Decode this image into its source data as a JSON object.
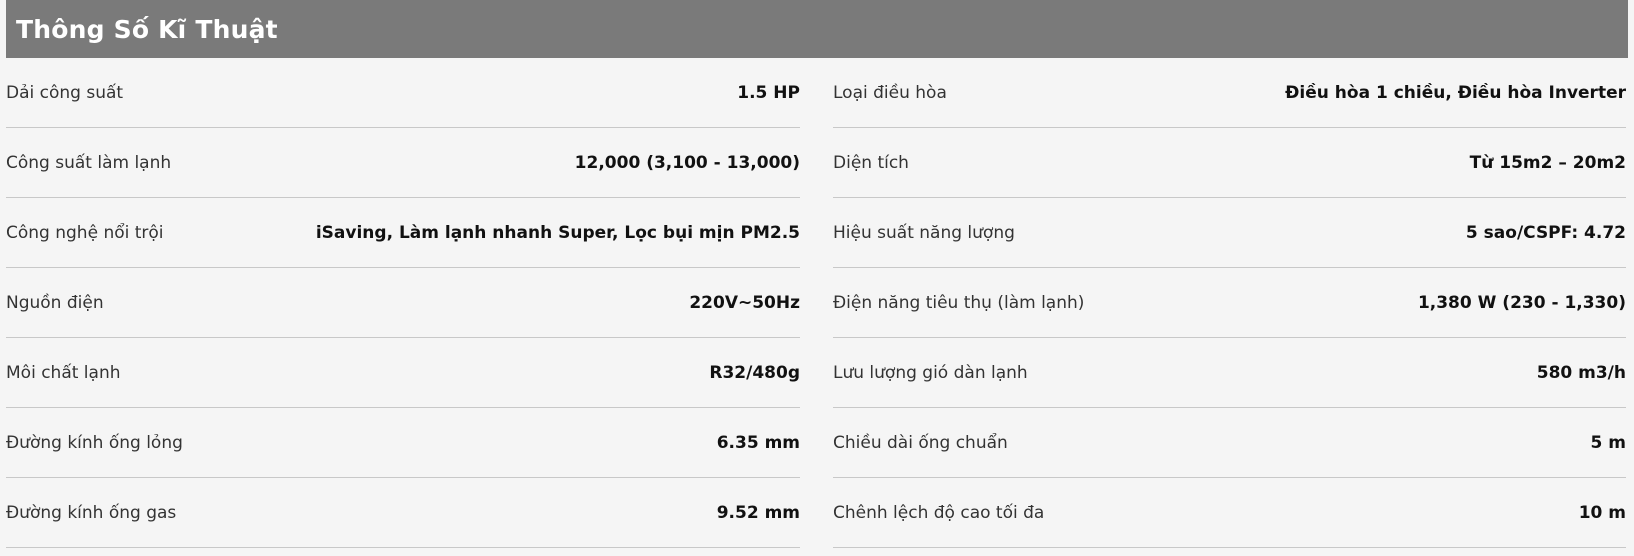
{
  "header": {
    "title": "Thông Số Kĩ Thuật"
  },
  "left": [
    {
      "label": "Dải công suất",
      "value": "1.5 HP"
    },
    {
      "label": "Công suất làm lạnh",
      "value": "12,000 (3,100 - 13,000)"
    },
    {
      "label": "Công nghệ nổi trội",
      "value": "iSaving, Làm lạnh nhanh Super, Lọc bụi mịn PM2.5"
    },
    {
      "label": "Nguồn điện",
      "value": "220V~50Hz"
    },
    {
      "label": "Môi chất lạnh",
      "value": "R32/480g"
    },
    {
      "label": "Đường kính ống lỏng",
      "value": "6.35 mm"
    },
    {
      "label": "Đường kính ống gas",
      "value": "9.52 mm"
    }
  ],
  "right": [
    {
      "label": "Loại điều hòa",
      "value": "Điều hòa 1 chiều, Điều hòa Inverter"
    },
    {
      "label": "Diện tích",
      "value": "Từ 15m2 – 20m2"
    },
    {
      "label": "Hiệu suất năng lượng",
      "value": "5 sao/CSPF: 4.72"
    },
    {
      "label": "Điện năng tiêu thụ (làm lạnh)",
      "value": "1,380 W (230 - 1,330)"
    },
    {
      "label": "Lưu lượng gió dàn lạnh",
      "value": "580 m3/h"
    },
    {
      "label": "Chiều dài ống chuẩn",
      "value": "5 m"
    },
    {
      "label": "Chênh lệch độ cao tối đa",
      "value": "10 m"
    }
  ]
}
